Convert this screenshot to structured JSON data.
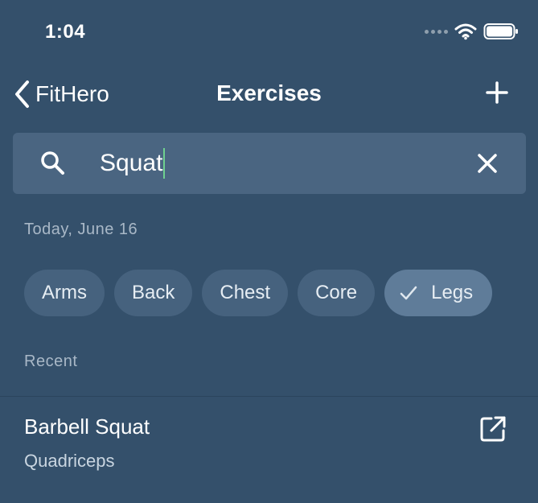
{
  "status_bar": {
    "time": "1:04",
    "icons": [
      "signal-dots-icon",
      "wifi-icon",
      "battery-icon"
    ]
  },
  "nav": {
    "back_label": "FitHero",
    "title": "Exercises",
    "back_icon": "chevron-left-icon",
    "add_icon": "plus-icon"
  },
  "search": {
    "value": "Squat",
    "icon": "search-icon",
    "clear_icon": "close-icon"
  },
  "date_label": "Today, June 16",
  "filters": [
    {
      "label": "Arms",
      "selected": false
    },
    {
      "label": "Back",
      "selected": false
    },
    {
      "label": "Chest",
      "selected": false
    },
    {
      "label": "Core",
      "selected": false
    },
    {
      "label": "Legs",
      "selected": true
    }
  ],
  "recent_label": "Recent",
  "recent_items": [
    {
      "title": "Barbell Squat",
      "subtitle": "Quadriceps",
      "action_icon": "open-external-icon"
    }
  ],
  "colors": {
    "background": "#34506b",
    "search_bg": "#4a6581",
    "chip_bg": "#46627e",
    "chip_selected_bg": "#5f7c99",
    "caret": "#6fd18f",
    "muted_text": "#a9b8c7"
  }
}
